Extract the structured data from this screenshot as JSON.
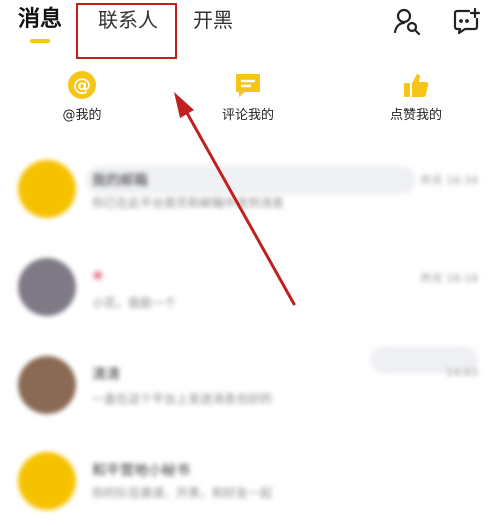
{
  "tabs": [
    {
      "label": "消息",
      "active": true
    },
    {
      "label": "联系人",
      "active": false
    },
    {
      "label": "开黑",
      "active": false
    }
  ],
  "header_icons": [
    "find-user-icon",
    "new-chat-icon"
  ],
  "shortcuts": [
    {
      "label": "@我的",
      "icon": "at-icon"
    },
    {
      "label": "评论我的",
      "icon": "comment-icon"
    },
    {
      "label": "点赞我的",
      "icon": "thumbs-up-icon"
    }
  ],
  "messages": [
    {
      "name": "我的邮箱",
      "preview": "你已在此平台首页和邮箱中收到消息",
      "time": "昨天 16:34"
    },
    {
      "name": "❀",
      "preview": "小花，我能一个",
      "time": "昨天 16:18"
    },
    {
      "name": "清清",
      "preview": "一直在这个平台上发送消息也好的",
      "time": "14:03"
    },
    {
      "name": "和平营地小秘书",
      "preview": "你的队伍邀请，开黑，和好友一起",
      "time": ""
    }
  ],
  "colors": {
    "accent": "#f5c518",
    "annotation": "#c0201e"
  }
}
